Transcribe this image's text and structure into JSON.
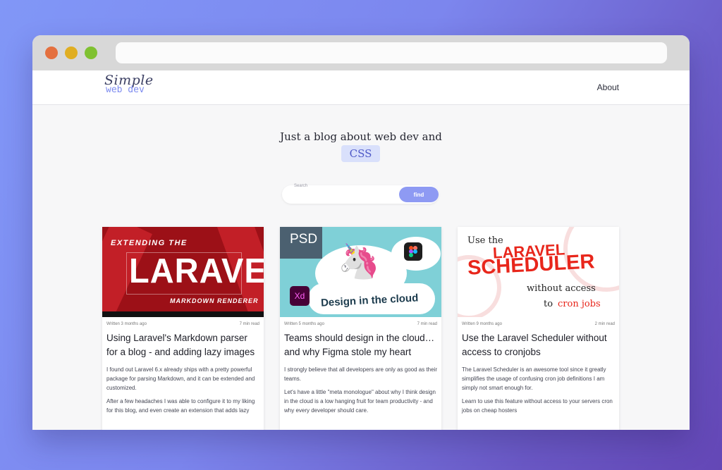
{
  "browser": {
    "url": ""
  },
  "header": {
    "logo_top": "Simple",
    "logo_bottom": "web dev",
    "nav_about": "About"
  },
  "hero": {
    "text": "Just a blog about web dev and",
    "tag": "CSS"
  },
  "search": {
    "label": "Search",
    "placeholder": "",
    "button": "find"
  },
  "posts": [
    {
      "written": "Written 3 months ago",
      "read_time": "7 min read",
      "title": "Using Laravel's Markdown parser for a blog - and adding lazy images",
      "paragraphs": [
        "I found out Laravel 6.x already ships with a pretty powerful package for parsing Markdown, and it can be extended and customized.",
        "After a few headaches I was able to configure it to my liking for this blog, and even create an extension that adds lazy"
      ],
      "thumb": {
        "line1": "EXTENDING THE",
        "line2": "LARAVEL",
        "line3": "MARKDOWN RENDERER"
      }
    },
    {
      "written": "Written 5 months ago",
      "read_time": "7 min read",
      "title": "Teams should design in the cloud… and why Figma stole my heart",
      "paragraphs": [
        "I strongly believe that all developers are only as good as their teams.",
        "Let's have a little \"meta monologue\" about why I think design in the cloud is a low hanging fruit for team productivity - and why every developer should care."
      ],
      "thumb": {
        "psd": "PSD",
        "xd": "Xd",
        "caption": "Design in the cloud"
      }
    },
    {
      "written": "Written 9 months ago",
      "read_time": "2 min read",
      "title": "Use the Laravel Scheduler without access to cronjobs",
      "paragraphs": [
        "The Laravel Scheduler is an awesome tool since it greatly simplifies the usage of confusing cron job definitions I am simply not smart enough for.",
        "Learn to use this feature without access to your servers cron jobs on cheap hosters"
      ],
      "thumb": {
        "line1": "Use the",
        "line2": "LARAVEL",
        "line3": "SCHEDULER",
        "line4": "without access",
        "line5a": "to",
        "line5b": "cron jobs"
      }
    }
  ],
  "colors": {
    "accent": "#8e9af3",
    "tag_bg": "#d9e0fb",
    "laravel_red": "#e8261b"
  }
}
